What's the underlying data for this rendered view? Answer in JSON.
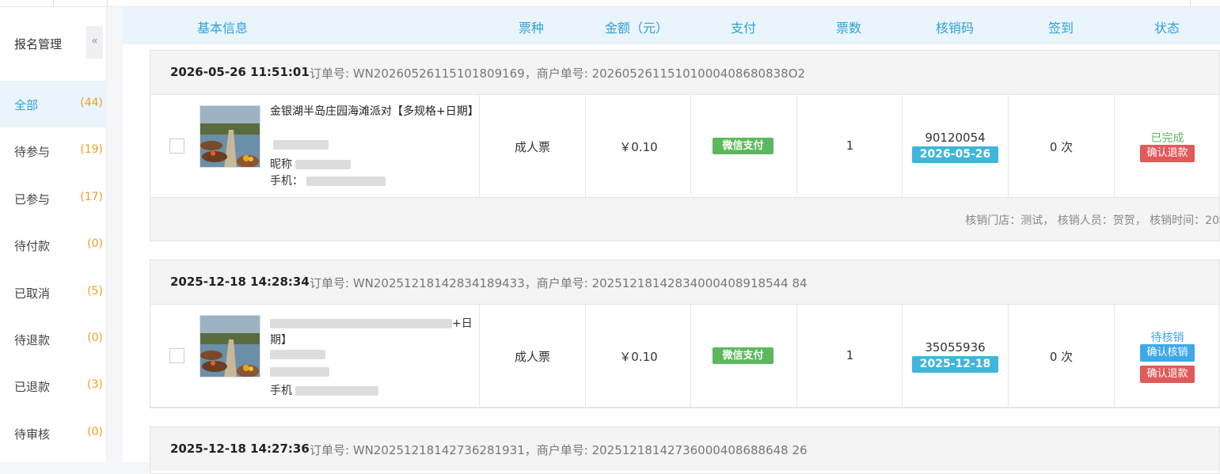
{
  "sidebar": {
    "title": "报名管理",
    "collapse_glyph": "«",
    "items": [
      {
        "label": "全部",
        "count": "(44)"
      },
      {
        "label": "待参与",
        "count": "(19)"
      },
      {
        "label": "已参与",
        "count": "(17)"
      },
      {
        "label": "待付款",
        "count": "(0)"
      },
      {
        "label": "已取消",
        "count": "(5)"
      },
      {
        "label": "待退款",
        "count": "(0)"
      },
      {
        "label": "已退款",
        "count": "(3)"
      },
      {
        "label": "待审核",
        "count": "(0)"
      }
    ]
  },
  "table": {
    "headers": [
      "基本信息",
      "票种",
      "金额（元）",
      "支付",
      "票数",
      "核销码",
      "签到",
      "状态"
    ]
  },
  "orders": [
    {
      "datetime": "2026-05-26 11:51:01",
      "order_info": "订单号: WN20260526115101809169，商户单号: 20260526115101000408680838O2",
      "product_name": "金银湖半岛庄园海滩派对【多规格+日期】",
      "nick_label": "昵称",
      "phone_label": "手机：",
      "ticket_type": "成人票",
      "amount": "￥0.10",
      "payment": "微信支付",
      "qty": "1",
      "code": "90120054",
      "code_date": "2026-05-26",
      "checkin": "0 次",
      "status": "已完成",
      "status_color": "#5cb85c",
      "actions": [
        "确认退款"
      ],
      "footer": "核销门店：测试，  核销人员：贺贺，  核销时间：20"
    },
    {
      "datetime": "2025-12-18 14:28:34",
      "order_info": "订单号: WN20251218142834189433，商户单号: 20251218142834000408918544 84",
      "product_name_tail": "+日",
      "product_name_line2": "期】",
      "phone_label": "手机",
      "ticket_type": "成人票",
      "amount": "￥0.10",
      "payment": "微信支付",
      "qty": "1",
      "code": "35055936",
      "code_date": "2025-12-18",
      "checkin": "0 次",
      "status": "待核销",
      "status_color": "#3fa8e8",
      "actions": [
        "确认核销",
        "确认退款"
      ]
    },
    {
      "datetime": "2025-12-18 14:27:36",
      "order_info": "订单号: WN20251218142736281931，商户单号: 20251218142736000408688648 26"
    }
  ]
}
